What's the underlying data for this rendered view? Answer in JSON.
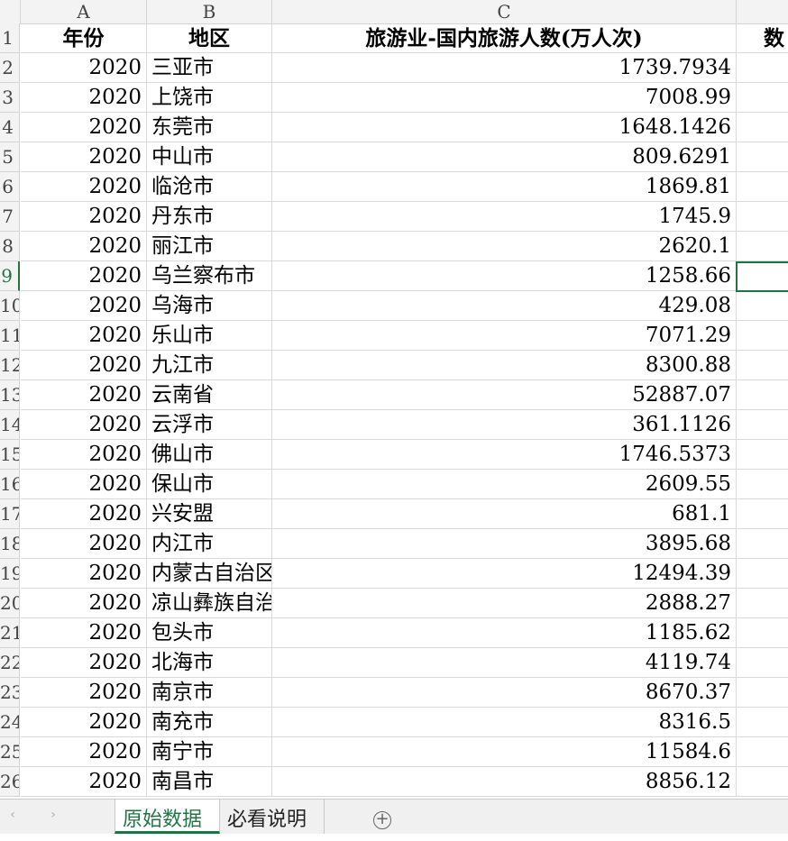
{
  "columns": [
    "A",
    "B",
    "C",
    ""
  ],
  "header_row": {
    "row_num": "1",
    "cells": [
      "年份",
      "地区",
      "旅游业-国内旅游人数(万人次)",
      "数"
    ]
  },
  "rows": [
    {
      "num": "2",
      "year": "2020",
      "region": "三亚市",
      "value": "1739.7934"
    },
    {
      "num": "3",
      "year": "2020",
      "region": "上饶市",
      "value": "7008.99"
    },
    {
      "num": "4",
      "year": "2020",
      "region": "东莞市",
      "value": "1648.1426"
    },
    {
      "num": "5",
      "year": "2020",
      "region": "中山市",
      "value": "809.6291"
    },
    {
      "num": "6",
      "year": "2020",
      "region": "临沧市",
      "value": "1869.81"
    },
    {
      "num": "7",
      "year": "2020",
      "region": "丹东市",
      "value": "1745.9"
    },
    {
      "num": "8",
      "year": "2020",
      "region": "丽江市",
      "value": "2620.1"
    },
    {
      "num": "9",
      "year": "2020",
      "region": "乌兰察布市",
      "value": "1258.66"
    },
    {
      "num": "10",
      "year": "2020",
      "region": "乌海市",
      "value": "429.08"
    },
    {
      "num": "11",
      "year": "2020",
      "region": "乐山市",
      "value": "7071.29"
    },
    {
      "num": "12",
      "year": "2020",
      "region": "九江市",
      "value": "8300.88"
    },
    {
      "num": "13",
      "year": "2020",
      "region": "云南省",
      "value": "52887.07"
    },
    {
      "num": "14",
      "year": "2020",
      "region": "云浮市",
      "value": "361.1126"
    },
    {
      "num": "15",
      "year": "2020",
      "region": "佛山市",
      "value": "1746.5373"
    },
    {
      "num": "16",
      "year": "2020",
      "region": "保山市",
      "value": "2609.55"
    },
    {
      "num": "17",
      "year": "2020",
      "region": "兴安盟",
      "value": "681.1"
    },
    {
      "num": "18",
      "year": "2020",
      "region": "内江市",
      "value": "3895.68"
    },
    {
      "num": "19",
      "year": "2020",
      "region": "内蒙古自治区",
      "value": "12494.39"
    },
    {
      "num": "20",
      "year": "2020",
      "region": "凉山彝族自治州",
      "value": "2888.27"
    },
    {
      "num": "21",
      "year": "2020",
      "region": "包头市",
      "value": "1185.62"
    },
    {
      "num": "22",
      "year": "2020",
      "region": "北海市",
      "value": "4119.74"
    },
    {
      "num": "23",
      "year": "2020",
      "region": "南京市",
      "value": "8670.37"
    },
    {
      "num": "24",
      "year": "2020",
      "region": "南充市",
      "value": "8316.5"
    },
    {
      "num": "25",
      "year": "2020",
      "region": "南宁市",
      "value": "11584.6"
    },
    {
      "num": "26",
      "year": "2020",
      "region": "南昌市",
      "value": "8856.12"
    }
  ],
  "tabs": {
    "prev_icon": "‹",
    "next_icon": "›",
    "sheet1": "原始数据",
    "sheet2": "必看说明",
    "add_icon": "+"
  },
  "colors": {
    "accent": "#217346"
  }
}
